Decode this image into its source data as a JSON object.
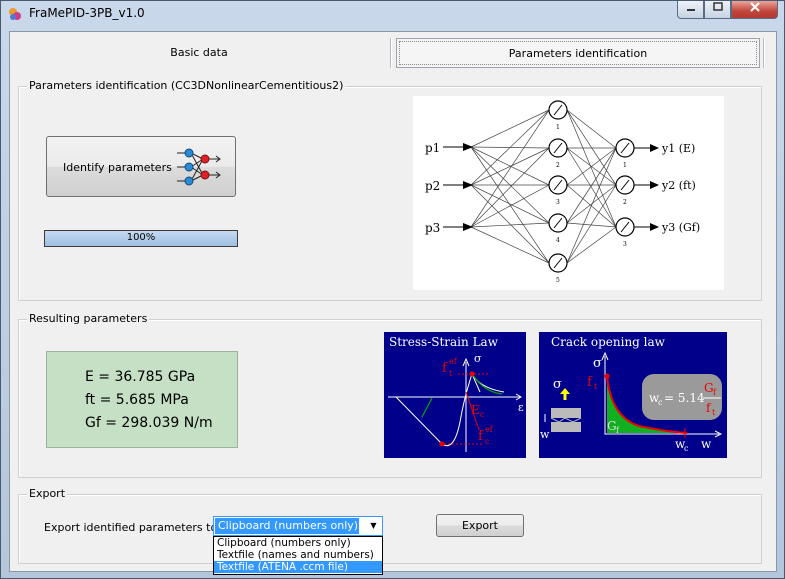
{
  "window": {
    "title": "FraMePID-3PB_v1.0"
  },
  "tabs": [
    {
      "label": "Basic data"
    },
    {
      "label": "Parameters identification"
    }
  ],
  "identification": {
    "group_label": "Parameters identification (CC3DNonlinearCementitious2)",
    "identify_button": "Identify parameters",
    "progress": {
      "value": 100,
      "text": "100%"
    },
    "network": {
      "inputs": [
        "p1",
        "p2",
        "p3"
      ],
      "hidden_count": 5,
      "output_count": 3,
      "outputs": [
        "y1 (E)",
        "y2 (ft)",
        "y3 (Gf)"
      ]
    }
  },
  "results": {
    "group_label": "Resulting parameters",
    "lines": [
      "E = 36.785 GPa",
      "ft = 5.685 MPa",
      "Gf = 298.039 N/m"
    ]
  },
  "stress_strain": {
    "title": "Stress-Strain Law",
    "labels": {
      "sigma": "σ",
      "epsilon": "ε",
      "ft_ef": "f",
      "ft_sub": "t",
      "ft_sup": "ef",
      "ec": "E",
      "ec_sub": "c",
      "fc_ef": "f",
      "fc_sub": "c",
      "fc_sup": "ef"
    }
  },
  "crack_law": {
    "title": "Crack opening law",
    "labels": {
      "sigma": "σ",
      "ft": "f",
      "ft_sub": "t",
      "gf": "G",
      "gf_sub": "f",
      "wc": "w",
      "wc_sub": "c",
      "w": "w",
      "formula": "w",
      "formula_sub": "c",
      "formula_value": "= 5.14",
      "frac_num": "G",
      "frac_num_sub": "f",
      "frac_den": "f",
      "frac_den_sub": "t",
      "side_sigma": "σ",
      "side_w": "w"
    }
  },
  "export": {
    "group_label": "Export",
    "label": "Export identified parameters to:",
    "selected": "Clipboard (numbers only)",
    "options": [
      "Clipboard (numbers only)",
      "Textfile (names and numbers)",
      "Textfile (ATENA .ccm file)"
    ],
    "highlighted_option": 2,
    "button": "Export"
  },
  "colors": {
    "nn_background": "#ffffff",
    "law_panels": "#00008b",
    "results_box": "#c5e0c4",
    "selection": "#3399ff"
  }
}
